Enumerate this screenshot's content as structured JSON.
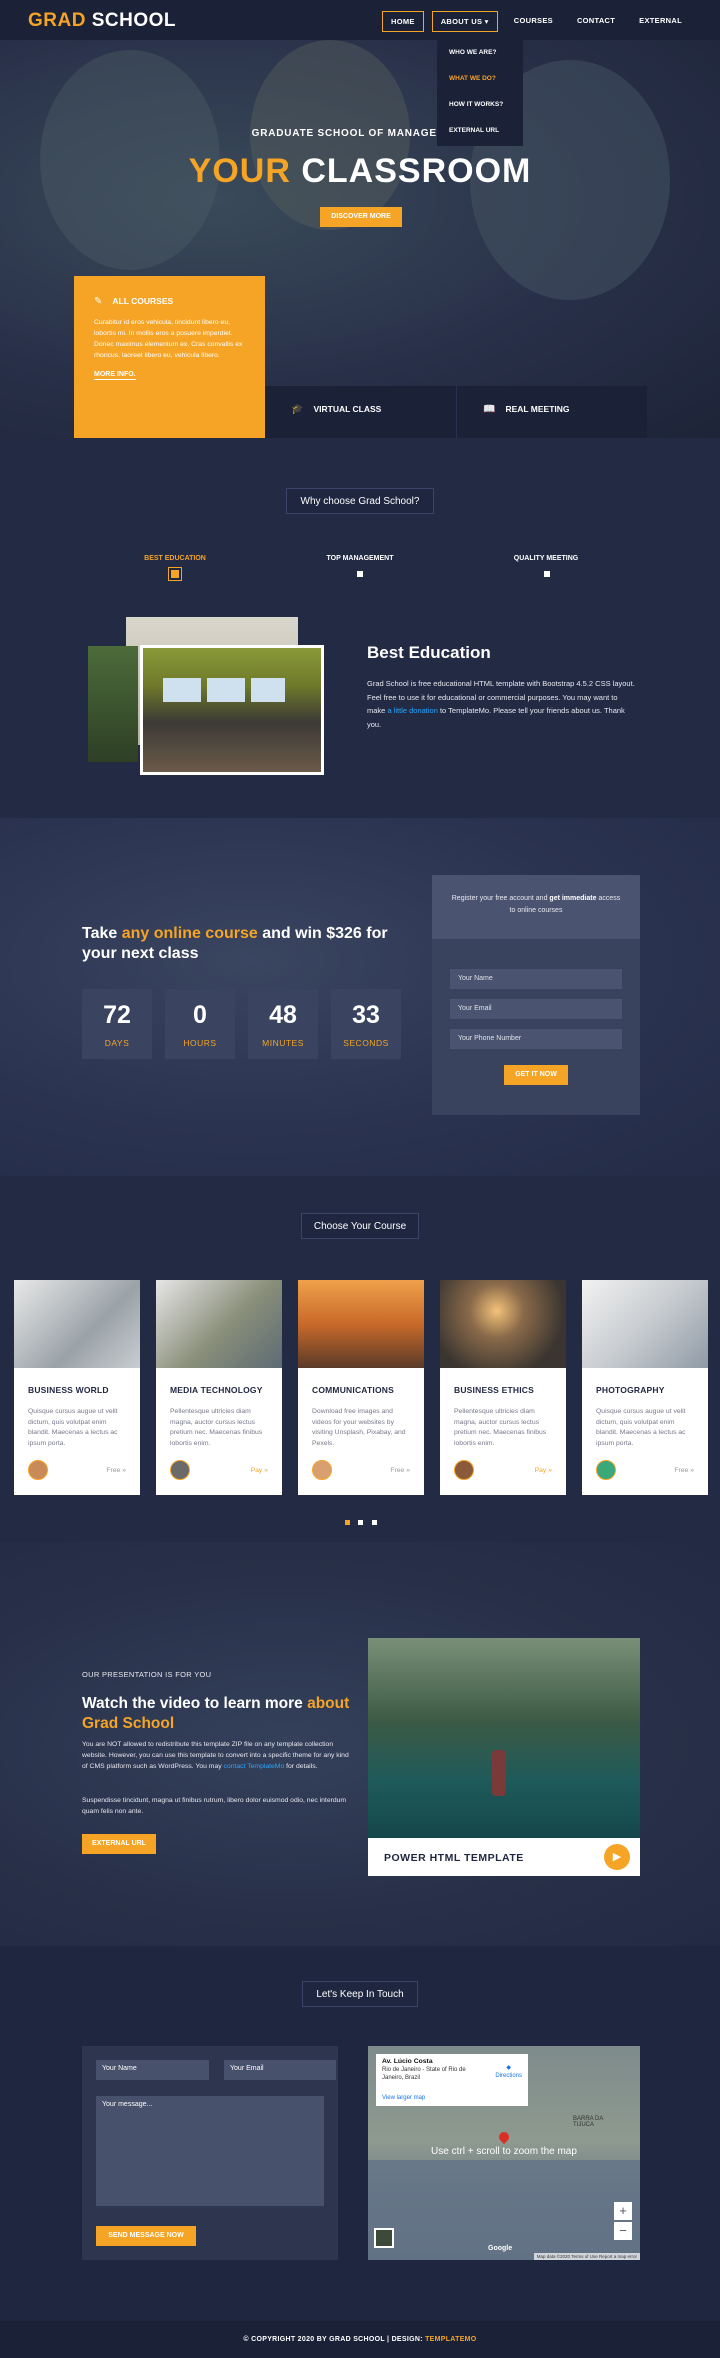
{
  "header": {
    "logo_a": "GRAD",
    "logo_b": " SCHOOL",
    "nav": [
      "HOME",
      "ABOUT US",
      "COURSES",
      "CONTACT",
      "EXTERNAL"
    ],
    "dropdown": [
      "WHO WE ARE?",
      "WHAT WE DO?",
      "HOW IT WORKS?",
      "EXTERNAL URL"
    ]
  },
  "hero": {
    "subtitle": "GRADUATE SCHOOL OF MANAGEMENT",
    "title_a": "YOUR",
    "title_b": " CLASSROOM",
    "button": "DISCOVER MORE"
  },
  "features": {
    "courses_title": "ALL COURSES",
    "courses_text": "Curabitur id eros vehicula, tincidunt libero eu, lobortis mi. In mollis eros a posuere imperdiet. Donec maximus elementum ex. Cras convallis ex rhoncus, laoreet libero eu, vehicula libero.",
    "courses_more": "MORE INFO.",
    "virtual": "VIRTUAL CLASS",
    "meeting": "REAL MEETING"
  },
  "why": {
    "heading": "Why choose Grad School?",
    "tabs": [
      "BEST EDUCATION",
      "TOP MANAGEMENT",
      "QUALITY MEETING"
    ],
    "title": "Best Education",
    "text_1": "Grad School is free educational HTML template with Bootstrap 4.5.2 CSS layout. Feel free to use it for educational or commercial purposes. You may want to make ",
    "link": "a little donation",
    "text_2": " to TemplateMo. Please tell your friends about us. Thank you."
  },
  "countdown": {
    "title_1": "Take ",
    "title_a": "any online course",
    "title_2": " and win $326 for your next class",
    "items": [
      {
        "n": "72",
        "l": "DAYS"
      },
      {
        "n": "0",
        "l": "HOURS"
      },
      {
        "n": "48",
        "l": "MINUTES"
      },
      {
        "n": "33",
        "l": "SECONDS"
      }
    ],
    "reg_text_1": "Register your free account and ",
    "reg_text_b": "get immediate",
    "reg_text_2": " access to online courses",
    "fields": [
      "Your Name",
      "Your Email",
      "Your Phone Number"
    ],
    "button": "GET IT NOW"
  },
  "courses": {
    "heading": "Choose Your Course",
    "items": [
      {
        "title": "BUSINESS WORLD",
        "desc": "Quisque cursus augue ut velit dictum, quis volutpat enim blandit. Maecenas a lectus ac ipsum porta.",
        "price": "Free »"
      },
      {
        "title": "MEDIA TECHNOLOGY",
        "desc": "Pellentesque ultricies diam magna, auctor cursus lectus pretium nec. Maecenas finibus lobortis enim.",
        "price": "Pay »"
      },
      {
        "title": "COMMUNICATIONS",
        "desc": "Download free images and videos for your websites by visiting Unsplash, Pixabay, and Pexels.",
        "price": "Free »"
      },
      {
        "title": "BUSINESS ETHICS",
        "desc": "Pellentesque ultricies diam magna, auctor cursus lectus pretium nec. Maecenas finibus lobortis enim.",
        "price": "Pay »"
      },
      {
        "title": "PHOTOGRAPHY",
        "desc": "Quisque cursus augue ut velit dictum, quis volutpat enim blandit. Maecenas a lectus ac ipsum porta.",
        "price": "Free »"
      }
    ]
  },
  "video": {
    "small": "OUR PRESENTATION IS FOR YOU",
    "title_1": "Watch the video to learn more ",
    "title_a": "about Grad School",
    "text_1": "You are NOT allowed to redistribute this template ZIP file on any template collection website. However, you can use this template to convert into a specific theme for any kind of CMS platform such as WordPress. You may ",
    "link": "contact TemplateMo",
    "text_2": " for details.",
    "text_3": "Suspendisse tincidunt, magna ut finibus rutrum, libero dolor euismod odio, nec interdum quam felis non ante.",
    "button": "EXTERNAL URL",
    "caption": "POWER HTML TEMPLATE"
  },
  "contact": {
    "heading": "Let's Keep In Touch",
    "name": "Your Name",
    "email": "Your Email",
    "message": "Your message...",
    "button": "SEND MESSAGE NOW",
    "map_place": "Av. Lúcio Costa",
    "map_addr": "Rio de Janeiro - State of Rio de Janeiro, Brazil",
    "map_dir": "Directions",
    "map_large": "View larger map",
    "map_msg": "Use ctrl + scroll to zoom the map",
    "map_label": "BARRA DA TIJUCA",
    "map_google": "Google",
    "map_foot": "Map data ©2020   Terms of Use   Report a map error"
  },
  "footer": {
    "text": "© COPYRIGHT 2020 BY GRAD SCHOOL | DESIGN: ",
    "brand": "TEMPLATEMO"
  },
  "colors": {
    "accent": "#f5a425",
    "dark": "#1f2640",
    "link": "#2aa6ff"
  }
}
